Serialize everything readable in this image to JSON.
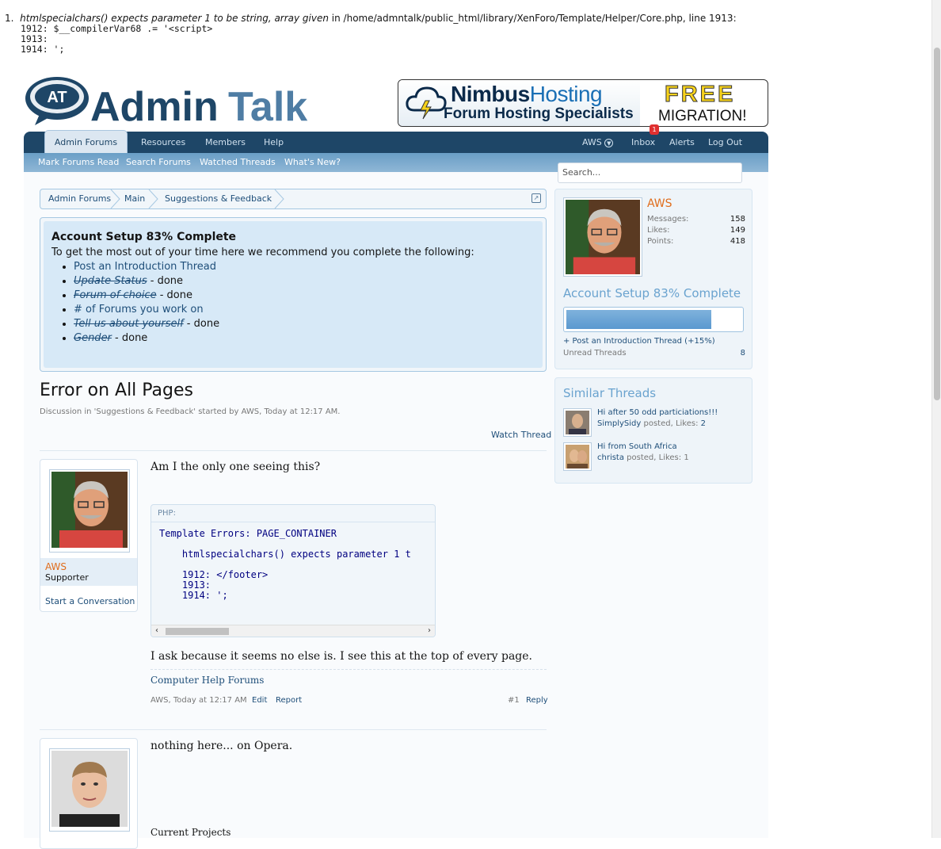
{
  "error": {
    "number": "1.",
    "message_italic": "htmlspecialchars() expects parameter 1 to be string, array given",
    "message_rest": " in /home/admntalk/public_html/library/XenForo/Template/Helper/Core.php, line 1913:",
    "code_lines": [
      "1912: $__compilerVar68 .= '<script>",
      "1913:",
      "1914: ';"
    ]
  },
  "logo": {
    "brand_a": "Admin",
    "brand_b": "Talk",
    "mark": "AT"
  },
  "ad": {
    "brand_bold": "Nimbus",
    "brand_light": "Hosting",
    "tagline": "Forum Hosting Specialists",
    "free": "FREE",
    "migration": "MIGRATION!"
  },
  "nav": {
    "tabs": [
      "Admin Forums",
      "Resources",
      "Members",
      "Help"
    ],
    "right": {
      "user": "AWS",
      "inbox": "Inbox",
      "inbox_count": "1",
      "alerts": "Alerts",
      "logout": "Log Out"
    },
    "sub": [
      "Mark Forums Read",
      "Search Forums",
      "Watched Threads",
      "What's New?"
    ]
  },
  "search": {
    "placeholder": "Search..."
  },
  "breadcrumb": [
    "Admin Forums",
    "Main",
    "Suggestions & Feedback"
  ],
  "setup": {
    "title": "Account Setup 83% Complete",
    "intro": "To get the most out of your time here we recommend you complete the following:",
    "items": [
      {
        "label": "Post an Introduction Thread",
        "done": false
      },
      {
        "label": "Update Status",
        "done": true
      },
      {
        "label": "Forum of choice",
        "done": true
      },
      {
        "label": "# of Forums you work on",
        "done": false
      },
      {
        "label": "Tell us about yourself",
        "done": true
      },
      {
        "label": "Gender",
        "done": true
      }
    ],
    "done_suffix": " - done"
  },
  "thread": {
    "title": "Error on All Pages",
    "meta": "Discussion in 'Suggestions & Feedback' started by AWS, Today at 12:17 AM.",
    "watch": "Watch Thread"
  },
  "posts": [
    {
      "user": "AWS",
      "role": "Supporter",
      "conversation": "Start a Conversation",
      "text1": "Am I the only one seeing this?",
      "code_label": "PHP:",
      "code_lines": [
        "Template Errors: PAGE_CONTAINER",
        "",
        "    htmlspecialchars() expects parameter 1 t",
        "",
        "    1912: </footer>",
        "    1913:",
        "    1914: ';"
      ],
      "text2": "I ask because it seems no else is. I see this at the top of every page.",
      "signature": "Computer Help Forums",
      "meta_author": "AWS, Today at 12:17 AM",
      "edit": "Edit",
      "report": "Report",
      "number": "#1",
      "reply": "Reply"
    },
    {
      "text1": "nothing here... on Opera.",
      "signature": "Current Projects"
    }
  ],
  "sidebar": {
    "user": "AWS",
    "stats": [
      {
        "label": "Messages:",
        "value": "158"
      },
      {
        "label": "Likes:",
        "value": "149"
      },
      {
        "label": "Points:",
        "value": "418"
      }
    ],
    "setup_title": "Account Setup 83% Complete",
    "progress": 0.83,
    "next_step": "+ Post an Introduction Thread (+15%)",
    "unread_label": "Unread Threads",
    "unread_value": "8",
    "similar_title": "Similar Threads",
    "similar": [
      {
        "title": "Hi after 50 odd particiations!!!",
        "user": "SimplySidy",
        "posted": " posted, Likes: ",
        "likes": "2"
      },
      {
        "title": "Hi from South Africa",
        "user": "christa",
        "posted": " posted, Likes: ",
        "likes": "1"
      }
    ]
  }
}
